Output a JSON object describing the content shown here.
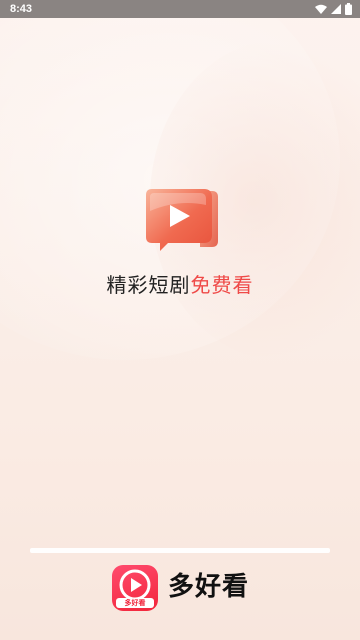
{
  "status_bar": {
    "time": "8:43",
    "icons": [
      "wifi-icon",
      "signal-icon",
      "battery-icon"
    ]
  },
  "splash": {
    "center_icon": "video-play-icon",
    "slogan_dark": "精彩短剧",
    "slogan_highlight": "免费看"
  },
  "brand": {
    "icon_label": "多好看",
    "name": "多好看"
  },
  "colors": {
    "accent": "#ef4a48",
    "brand": "#f2263a",
    "status_bar": "#8a8482",
    "background": "#fbeee8"
  }
}
